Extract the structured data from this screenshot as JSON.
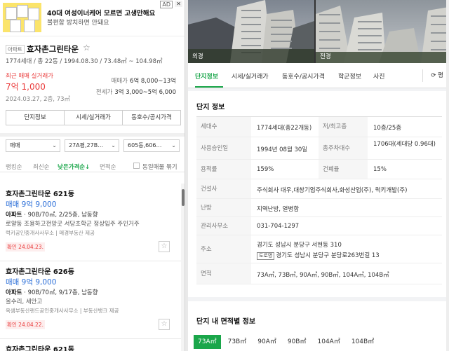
{
  "ad": {
    "badge": "AD",
    "title": "40대 여성이너케어 모르면 고생만해요",
    "subtitle": "불편함 방치하면 안돼요"
  },
  "complex": {
    "tag": "아파트",
    "name": "효자촌그린타운",
    "summary": "1774세대 / 총 22동 / 1994.08.30 / 73.48㎡ ~ 104.98㎡",
    "recent_label": "최근 매매 실거래가",
    "recent_price": "7억 1,000",
    "recent_date": "2024.03.27, 2층, 73㎡",
    "sale_label": "매매가",
    "sale_value": "6억 8,000~13억",
    "jeonse_label": "전세가",
    "jeonse_value": "3억 3,000~5억 6,000"
  },
  "buttons": [
    "단지정보",
    "시세/실거래가",
    "동호수/공시가격"
  ],
  "filters": {
    "trade": "매매",
    "area": "27A평,27B…",
    "dong": "605동,606…"
  },
  "sort": {
    "options": [
      "랭킹순",
      "최신순",
      "낮은가격순↓",
      "면적순"
    ],
    "same_listing": "동일매물 묶기"
  },
  "listings": [
    {
      "name": "효자촌그린타운 621동",
      "price": "매매 9억 9,000",
      "type": "아파트",
      "spec": " · 90B/70㎡, 2/25층, 남동향",
      "desc": "로얄동 조용하고전망굿 서당초학군 정상입주 주인거주",
      "agent": "럭키공인중개사사무소  |  매경부동산 제공",
      "confirm": "확인 24.04.23."
    },
    {
      "name": "효자촌그린타운 626동",
      "price": "매매 9억 9,000",
      "type": "아파트",
      "spec": " · 90B/70㎡, 9/17층, 남동향",
      "desc": "올수리, 세안고",
      "agent": "옥샘부동산랜드공인중개사사무소  |  부동산뱅크 제공",
      "confirm": "확인 24.04.22."
    },
    {
      "name": "효자촌그린타운 621동",
      "price": "",
      "type": "",
      "spec": "",
      "desc": "",
      "agent": "",
      "confirm": ""
    }
  ],
  "photos": [
    "외경",
    "전경"
  ],
  "tabs": [
    "단지정보",
    "시세/실거래가",
    "동호수/공시가격",
    "학군정보",
    "사진"
  ],
  "pyeong": "평",
  "info": {
    "title": "단지 정보",
    "households_label": "세대수",
    "households": "1774세대(총22개동)",
    "floors_label": "저/최고층",
    "floors": "10층/25층",
    "approval_label": "사용승인일",
    "approval": "1994년 08월 30일",
    "parking_label": "총주차대수",
    "parking": "1706대(세대당 0.96대)",
    "far_label": "용적률",
    "far": "159%",
    "bcr_label": "건폐율",
    "bcr": "15%",
    "builder_label": "건설사",
    "builder": "주식회사 대우,대창기업주식회사,화성산업(주), 럭키개발(주)",
    "heating_label": "난방",
    "heating": "지역난방, 열병합",
    "office_label": "관리사무소",
    "office": "031-704-1297",
    "address_label": "주소",
    "address": "경기도 성남시 분당구 서현동 310",
    "road_badge": "도로명",
    "road_address": "경기도 성남시 분당구 분당로263번길 13",
    "area_label": "면적",
    "areas": "73A㎡, 73B㎡, 90A㎡, 90B㎡, 104A㎡, 104B㎡"
  },
  "area_section": {
    "title": "단지 내 면적별 정보",
    "chips": [
      "73A㎡",
      "73B㎡",
      "90A㎡",
      "90B㎡",
      "104A㎡",
      "104B㎡"
    ]
  }
}
